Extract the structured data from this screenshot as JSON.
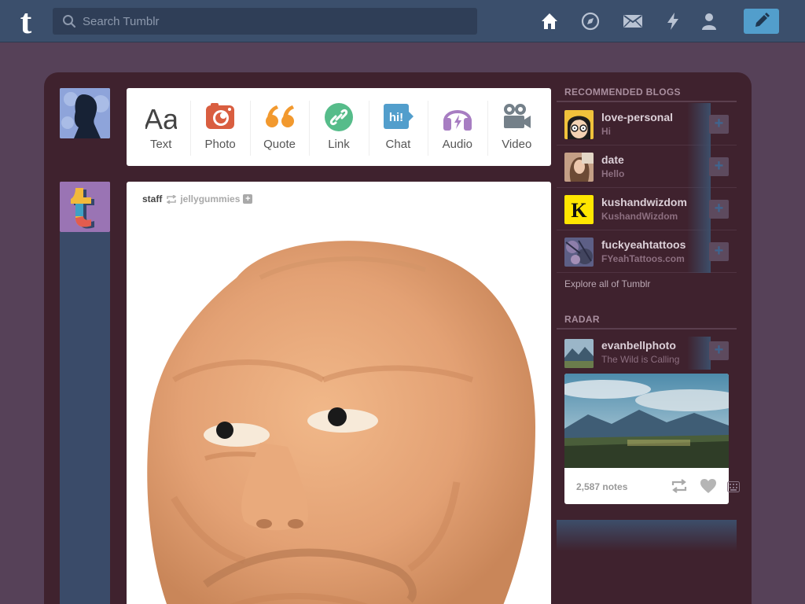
{
  "header": {
    "logo_letter": "t",
    "search_placeholder": "Search Tumblr",
    "nav_icons": [
      "home-icon",
      "explore-compass-icon",
      "inbox-mail-icon",
      "activity-lightning-icon",
      "account-person-icon"
    ],
    "compose_icon": "pencil-icon"
  },
  "post_types": [
    {
      "label": "Text",
      "icon": "text-aa-icon",
      "color": "#444444"
    },
    {
      "label": "Photo",
      "icon": "camera-icon",
      "color": "#d95e40"
    },
    {
      "label": "Quote",
      "icon": "quote-icon",
      "color": "#f2992e"
    },
    {
      "label": "Link",
      "icon": "link-icon",
      "color": "#56bc8a"
    },
    {
      "label": "Chat",
      "icon": "chat-bubble-icon",
      "color": "#529ecc",
      "bubble_text": "hi!"
    },
    {
      "label": "Audio",
      "icon": "headphones-icon",
      "color": "#a77dc2"
    },
    {
      "label": "Video",
      "icon": "video-camera-icon",
      "color": "#748089"
    }
  ],
  "post": {
    "author": "staff",
    "reblogged_from": "jellygummies",
    "follow_symbol": "+"
  },
  "sidebar": {
    "recommended_title": "RECOMMENDED BLOGS",
    "blogs": [
      {
        "name": "love-personal",
        "subtitle": "Hi"
      },
      {
        "name": "date",
        "subtitle": "Hello"
      },
      {
        "name": "kushandwizdom",
        "subtitle": "KushandWizdom",
        "thumb_letter": "K"
      },
      {
        "name": "fuckyeahtattoos",
        "subtitle": "FYeahTattoos.com"
      }
    ],
    "follow_symbol": "+",
    "explore_link": "Explore all of Tumblr",
    "radar_title": "RADAR",
    "radar": {
      "name": "evanbellphoto",
      "subtitle": "The Wild is Calling",
      "notes": "2,587 notes"
    }
  },
  "colors": {
    "header": "#3b4f6c",
    "background": "#564158",
    "frame": "#3f222e",
    "accent_blue": "#529ecc"
  }
}
